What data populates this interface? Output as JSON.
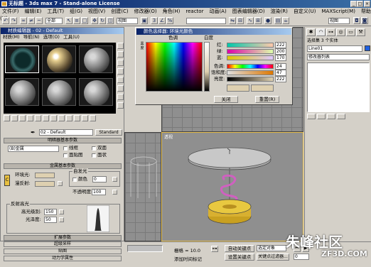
{
  "window": {
    "title": "无标题 - 3ds max 7 - Stand-alone License",
    "min": "_",
    "max": "□",
    "close": "×"
  },
  "menu": [
    "文件(F)",
    "编辑(E)",
    "工具(T)",
    "组(G)",
    "视图(V)",
    "创建(C)",
    "修改器(O)",
    "角色(H)",
    "reactor",
    "动画(A)",
    "图表编辑器(D)",
    "渲染(R)",
    "自定义(U)",
    "MAXScript(M)",
    "帮助(H)"
  ],
  "toolbar": {
    "filter": "全部",
    "view": "视图",
    "named_sel": ""
  },
  "material_editor": {
    "title": "材质编辑器 - 02 - Default",
    "menu": [
      "材质(M)",
      "导航(N)",
      "选项(O)",
      "工具(U)"
    ],
    "material_name": "02 - Default",
    "material_type": "Standard",
    "rollouts": {
      "shader_basic": "明暗器基本参数",
      "shader": "(B)金属",
      "wire": "线框",
      "two_sided": "双面",
      "face_map": "面贴图",
      "faceted": "面状",
      "metal_basic": "金属基本参数",
      "ambient": "环境光:",
      "diffuse": "漫反射:",
      "self_illum": "自发光",
      "color_cb": "颜色",
      "self_illum_val": "0",
      "opacity": "不透明度:",
      "opacity_val": "100",
      "specular_section": "反射高光",
      "spec_level": "高光级别:",
      "spec_level_val": "150",
      "glossiness": "光泽度:",
      "glossiness_val": "50",
      "extended": "扩展参数",
      "supersampling": "超级采样",
      "maps": "贴图",
      "dynamics": "动力学属性"
    }
  },
  "color_selector": {
    "title": "颜色选择器: 环境光颜色",
    "hue_label": "色调",
    "whiteness_label": "白度",
    "blackness_label": "黑度",
    "red_label": "红:",
    "red_val": "222",
    "green_label": "绿:",
    "green_val": "200",
    "blue_label": "蓝:",
    "blue_val": "170",
    "hue_val_label": "色调:",
    "hue_val": "24",
    "sat_label": "饱和度:",
    "sat_val": "47",
    "val_label": "亮度:",
    "val_val": "222",
    "close": "关闭",
    "reset": "重置(R)"
  },
  "viewport": {
    "label": "透视"
  },
  "command_panel": {
    "object_name": "Line01",
    "modifier_list": "修改器列表",
    "header": "选择集 3 个实体"
  },
  "status": {
    "grid_label": "栅格 = 10.0",
    "auto_key": "自动关键点",
    "selected": "选定对象",
    "set_key": "设置关键点",
    "key_filters": "关键点过滤器...",
    "add_time_tag": "添加时间标记",
    "frame": "0"
  },
  "watermark": {
    "text": "朱峰社区",
    "url": "ZF3D.COM"
  }
}
